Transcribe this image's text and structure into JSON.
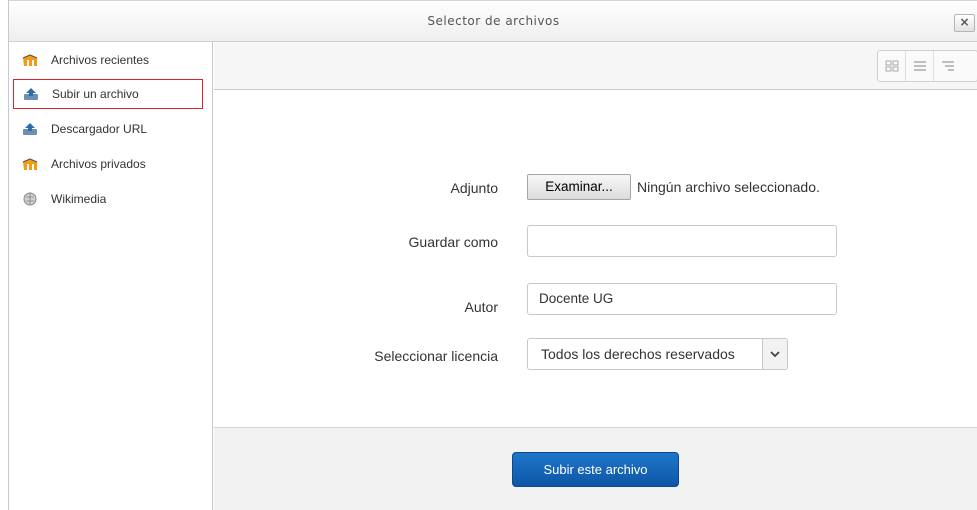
{
  "dialog": {
    "title": "Selector de archivos",
    "close_icon": "×"
  },
  "sidebar": {
    "items": [
      {
        "label": "Archivos recientes",
        "icon": "moodle-repository-icon"
      },
      {
        "label": "Subir un archivo",
        "icon": "upload-icon",
        "selected": true
      },
      {
        "label": "Descargador URL",
        "icon": "url-download-icon"
      },
      {
        "label": "Archivos privados",
        "icon": "moodle-repository-icon"
      },
      {
        "label": "Wikimedia",
        "icon": "wikimedia-icon"
      }
    ]
  },
  "toolbar": {
    "views": [
      "icon-view-icon",
      "list-view-icon",
      "tree-view-icon"
    ]
  },
  "form": {
    "attachment_label": "Adjunto",
    "browse_label": "Examinar...",
    "no_file_text": "Ningún archivo seleccionado.",
    "save_as_label": "Guardar como",
    "save_as_value": "",
    "author_label": "Autor",
    "author_value": "Docente UG",
    "license_label": "Seleccionar licencia",
    "license_value": "Todos los derechos reservados"
  },
  "footer": {
    "submit_label": "Subir este archivo"
  },
  "colors": {
    "selected_border": "#d9232e",
    "primary_button": "#1565b8"
  }
}
